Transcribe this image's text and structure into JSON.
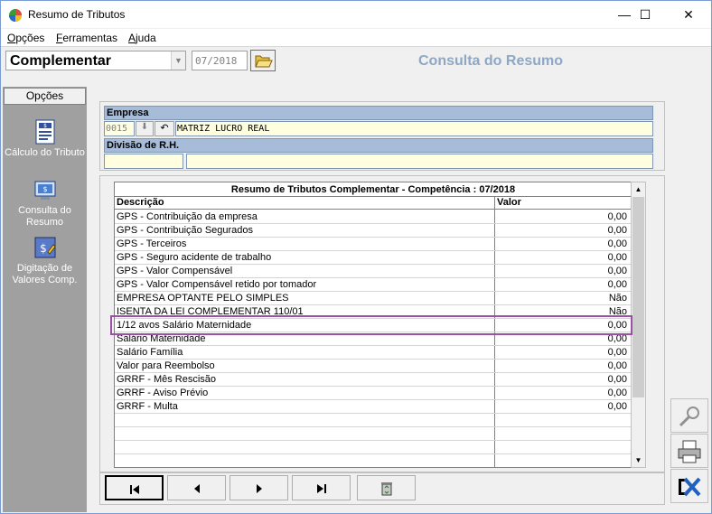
{
  "window": {
    "title": "Resumo de Tributos"
  },
  "window_controls": {
    "minimize": "—",
    "maximize": "☐",
    "close": "✕"
  },
  "menu": [
    {
      "label": "Opções",
      "underline": "O"
    },
    {
      "label": "Ferramentas",
      "underline": "F"
    },
    {
      "label": "Ajuda",
      "underline": "A"
    }
  ],
  "toolbar": {
    "mode_value": "Complementar",
    "competencia": "07/2018",
    "header_title": "Consulta do Resumo"
  },
  "sidebar": {
    "tab": "Opções",
    "items": [
      {
        "label": "Cálculo do Tributo",
        "icon": "document-calc-icon"
      },
      {
        "label": "Consulta do Resumo",
        "icon": "computer-search-icon"
      },
      {
        "label": "Digitação de Valores Comp.",
        "icon": "money-edit-icon"
      }
    ]
  },
  "empresa": {
    "label": "Empresa",
    "code": "0015",
    "name": "MATRIZ LUCRO REAL"
  },
  "divisao": {
    "label": "Divisão de R.H.",
    "code": "",
    "name": ""
  },
  "grid": {
    "title": "Resumo de Tributos Complementar - Competência : 07/2018",
    "columns": [
      "Descrição",
      "Valor"
    ],
    "rows": [
      {
        "desc": "GPS - Contribuição da empresa",
        "value": "0,00"
      },
      {
        "desc": "GPS - Contribuição Segurados",
        "value": "0,00"
      },
      {
        "desc": "GPS - Terceiros",
        "value": "0,00"
      },
      {
        "desc": "GPS - Seguro acidente de trabalho",
        "value": "0,00"
      },
      {
        "desc": "GPS - Valor Compensável",
        "value": "0,00"
      },
      {
        "desc": "GPS - Valor Compensável retido por tomador",
        "value": "0,00"
      },
      {
        "desc": "EMPRESA OPTANTE PELO SIMPLES",
        "value": "Não"
      },
      {
        "desc": "ISENTA DA LEI COMPLEMENTAR 110/01",
        "value": "Não"
      },
      {
        "desc": "1/12 avos Salário Maternidade",
        "value": "0,00"
      },
      {
        "desc": "Salário Maternidade",
        "value": "0,00"
      },
      {
        "desc": "Salário Família",
        "value": "0,00"
      },
      {
        "desc": "Valor para Reembolso",
        "value": "0,00"
      },
      {
        "desc": "GRRF - Mês Rescisão",
        "value": "0,00"
      },
      {
        "desc": "GRRF - Aviso Prévio",
        "value": "0,00"
      },
      {
        "desc": "GRRF - Multa",
        "value": "0,00"
      },
      {
        "desc": "",
        "value": ""
      },
      {
        "desc": "",
        "value": ""
      },
      {
        "desc": "",
        "value": ""
      },
      {
        "desc": "",
        "value": ""
      }
    ],
    "highlighted_row": 8
  },
  "nav": [
    {
      "name": "first-record-button",
      "glyph": "⏮"
    },
    {
      "name": "prev-record-button",
      "glyph": "◀"
    },
    {
      "name": "next-record-button",
      "glyph": "▶"
    },
    {
      "name": "last-record-button",
      "glyph": "⏭"
    },
    {
      "name": "delete-button",
      "glyph": "♻"
    }
  ],
  "colors": {
    "header_title": "#8ea7c4",
    "label_bar": "#a6bcd8",
    "field_bg": "#ffffe0",
    "highlight_border": "#9b4fa5",
    "sidebar_bg": "#a0a0a0"
  }
}
